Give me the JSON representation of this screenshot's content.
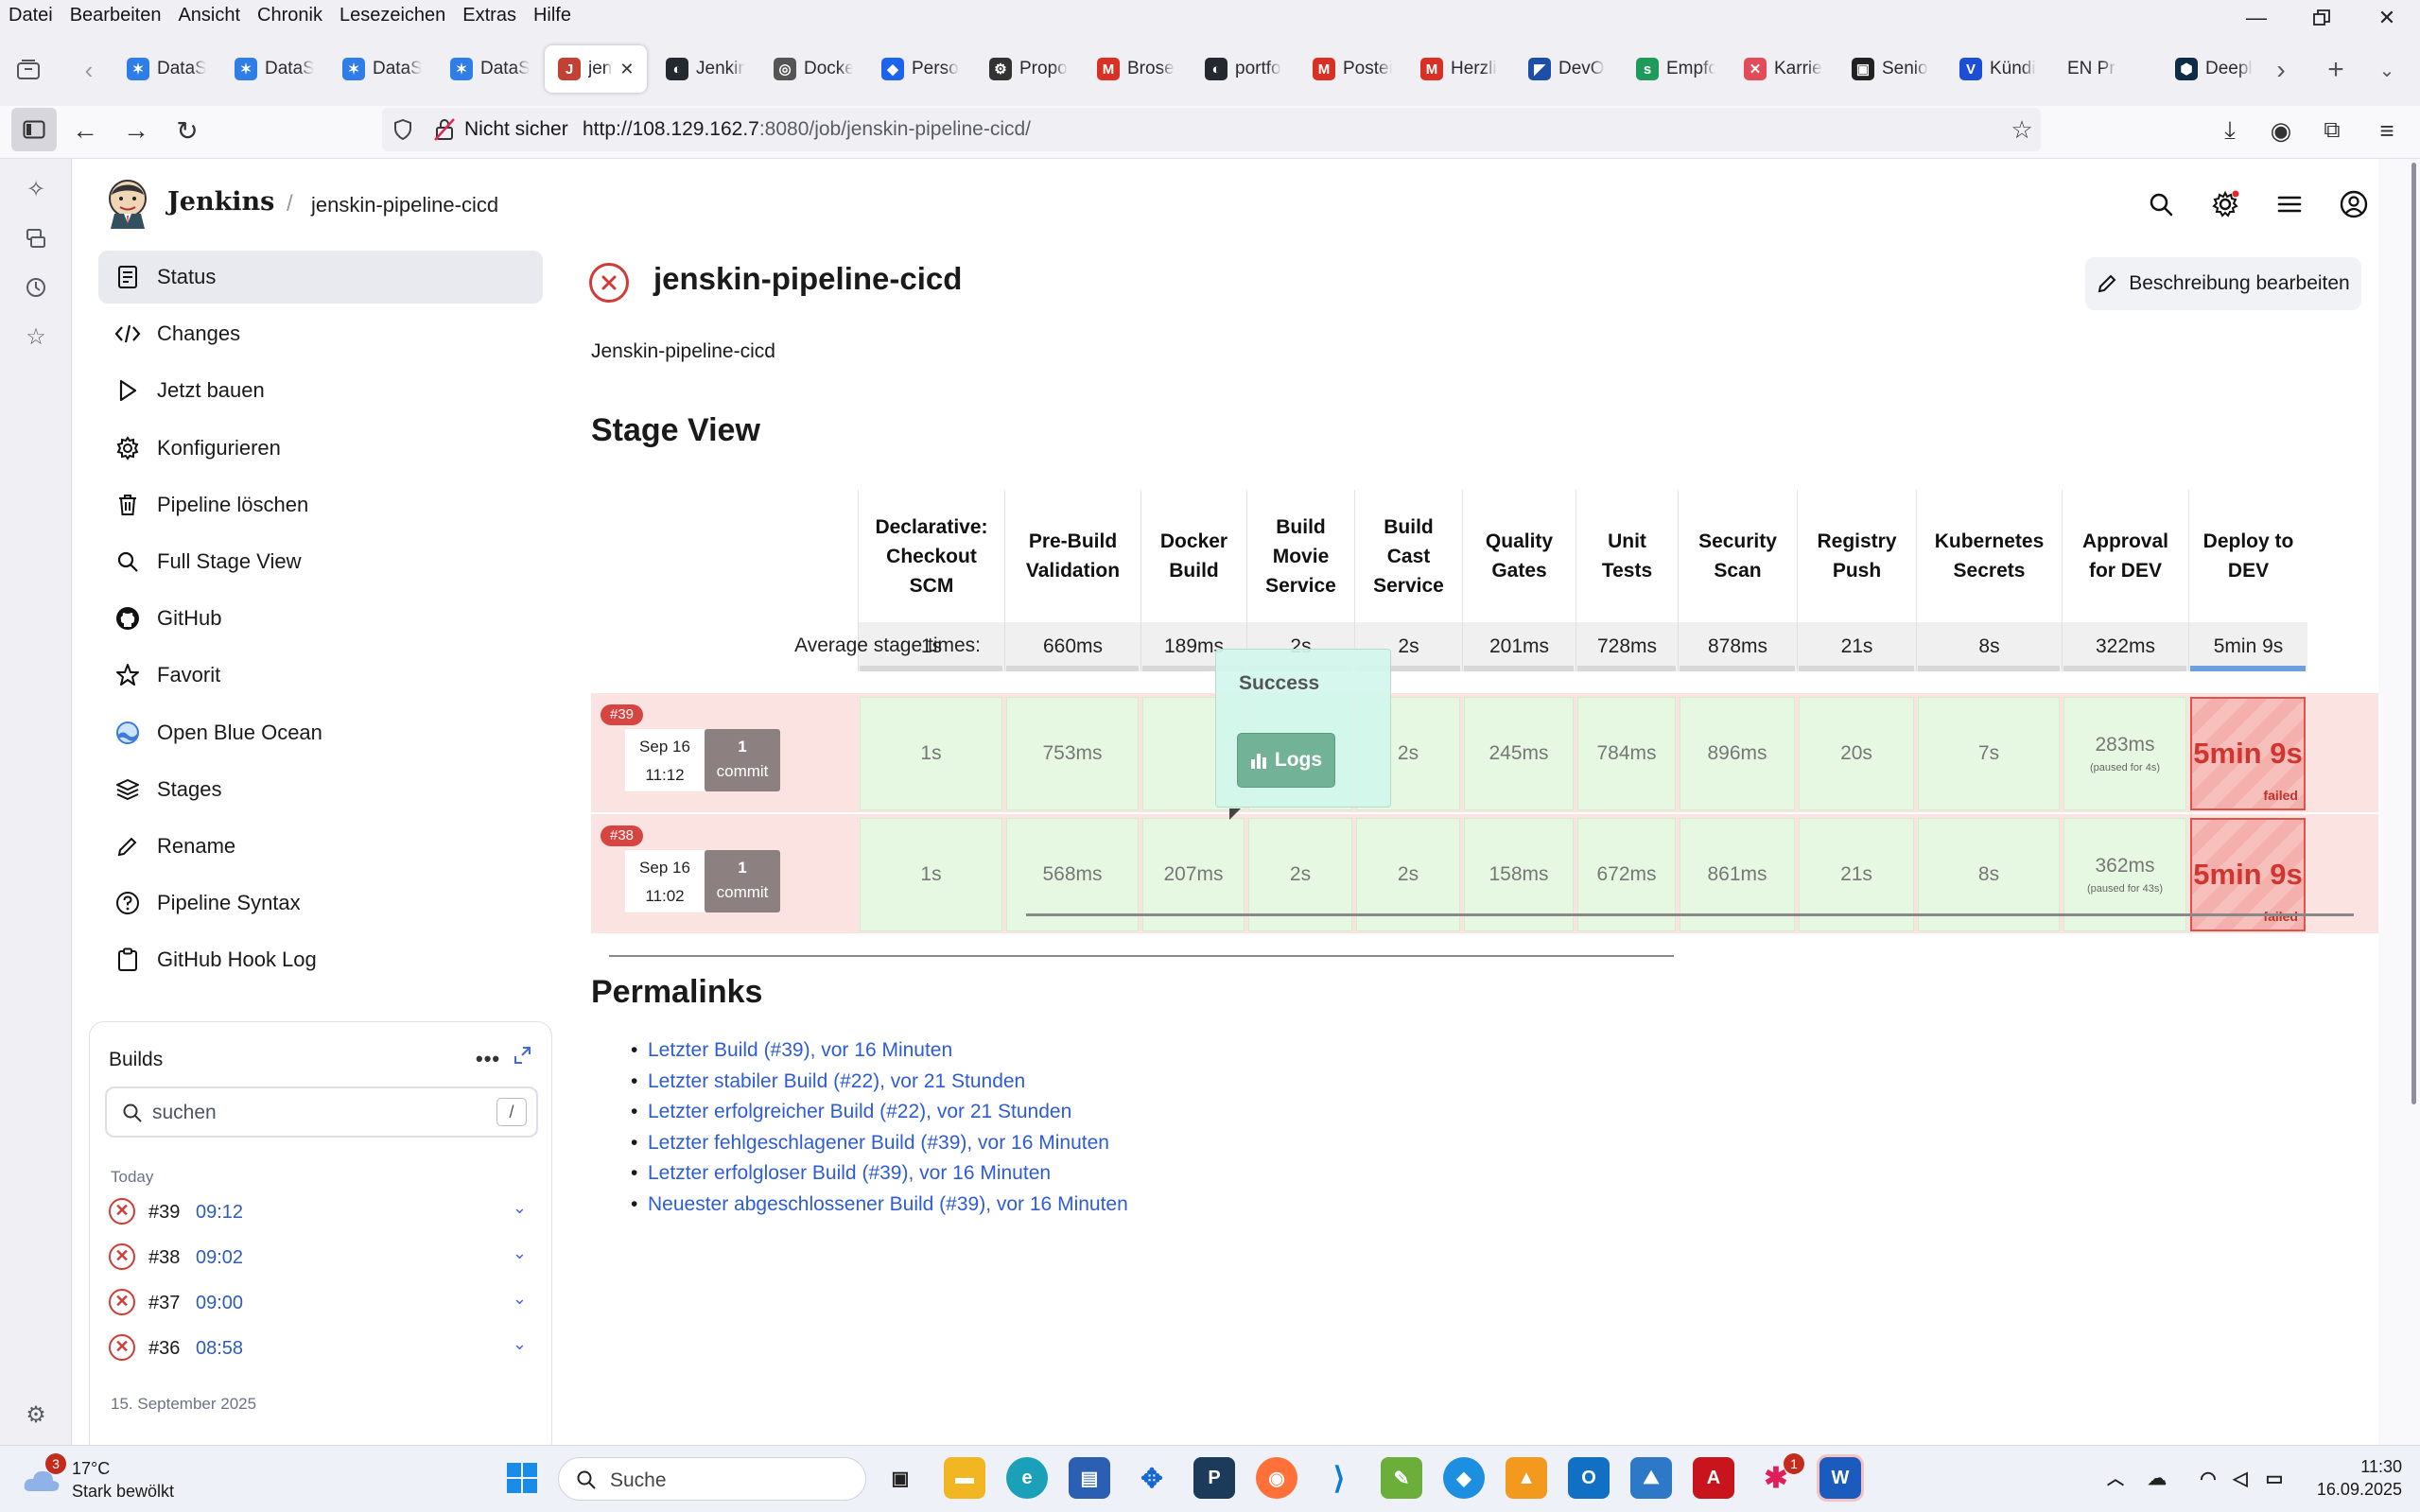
{
  "browser": {
    "menu": [
      "Datei",
      "Bearbeiten",
      "Ansicht",
      "Chronik",
      "Lesezeichen",
      "Extras",
      "Hilfe"
    ],
    "tabs": [
      {
        "label": "DataS",
        "color": "#2f7ee8",
        "glyph": "✶"
      },
      {
        "label": "DataS",
        "color": "#2f7ee8",
        "glyph": "✶"
      },
      {
        "label": "DataS",
        "color": "#2f7ee8",
        "glyph": "✶"
      },
      {
        "label": "DataS",
        "color": "#2f7ee8",
        "glyph": "✶"
      },
      {
        "label": "jen",
        "color": "#c24133",
        "glyph": "J"
      },
      {
        "label": "Jenkin",
        "color": "#24292f",
        "glyph": "◐"
      },
      {
        "label": "Docke",
        "color": "#555555",
        "glyph": "◎"
      },
      {
        "label": "Perso",
        "color": "#1d63ed",
        "glyph": "◆"
      },
      {
        "label": "Propo",
        "color": "#333333",
        "glyph": "⚙"
      },
      {
        "label": "Brose",
        "color": "#d93025",
        "glyph": "M"
      },
      {
        "label": "portfo",
        "color": "#24292f",
        "glyph": "◐"
      },
      {
        "label": "Postei",
        "color": "#d93025",
        "glyph": "M"
      },
      {
        "label": "Herzli",
        "color": "#d93025",
        "glyph": "M"
      },
      {
        "label": "DevO",
        "color": "#1e4fa8",
        "glyph": "◤"
      },
      {
        "label": "Empfo",
        "color": "#1e9b5a",
        "glyph": "s"
      },
      {
        "label": "Karrie",
        "color": "#e34b5b",
        "glyph": "✕"
      },
      {
        "label": "Senio",
        "color": "#222222",
        "glyph": "▣"
      },
      {
        "label": "Kündi",
        "color": "#1d4ed8",
        "glyph": "V"
      },
      {
        "label": "EN Project",
        "color": "#ffffff",
        "glyph": ""
      },
      {
        "label": "Deepl",
        "color": "#0f2b46",
        "glyph": "⬢"
      }
    ],
    "insecure_label": "Nicht sicher",
    "url_host": "http://108.129.162.7",
    "url_rest": ":8080/job/jenskin-pipeline-cicd/"
  },
  "jenkins": {
    "brand": "Jenkins",
    "breadcrumb": "jenskin-pipeline-cicd",
    "nav": [
      {
        "label": "Status",
        "icon": "status-icon"
      },
      {
        "label": "Changes",
        "icon": "code-icon"
      },
      {
        "label": "Jetzt bauen",
        "icon": "play-icon"
      },
      {
        "label": "Konfigurieren",
        "icon": "gear-icon"
      },
      {
        "label": "Pipeline löschen",
        "icon": "trash-icon"
      },
      {
        "label": "Full Stage View",
        "icon": "search-icon"
      },
      {
        "label": "GitHub",
        "icon": "github-icon"
      },
      {
        "label": "Favorit",
        "icon": "star-icon"
      },
      {
        "label": "Open Blue Ocean",
        "icon": "blue-ocean-icon"
      },
      {
        "label": "Stages",
        "icon": "layers-icon"
      },
      {
        "label": "Rename",
        "icon": "pencil-icon"
      },
      {
        "label": "Pipeline Syntax",
        "icon": "help-icon"
      },
      {
        "label": "GitHub Hook Log",
        "icon": "clipboard-icon"
      }
    ],
    "builds": {
      "title": "Builds",
      "search_placeholder": "suchen",
      "shortcut": "/",
      "today_label": "Today",
      "items": [
        {
          "num": "#39",
          "time": "09:12"
        },
        {
          "num": "#38",
          "time": "09:02"
        },
        {
          "num": "#37",
          "time": "09:00"
        },
        {
          "num": "#36",
          "time": "08:58"
        }
      ],
      "prev_day_label": "15. September 2025"
    },
    "title": "jenskin-pipeline-cicd",
    "edit_button": "Beschreibung bearbeiten",
    "description": "Jenskin-pipeline-cicd",
    "stage_view_title": "Stage View",
    "avg_label": "Average stage times:",
    "stages": [
      {
        "name": "Declarative: Checkout SCM",
        "avg": "1s"
      },
      {
        "name": "Pre-Build Validation",
        "avg": "660ms"
      },
      {
        "name": "Docker Build",
        "avg": "189ms"
      },
      {
        "name": "Build Movie Service",
        "avg": "2s"
      },
      {
        "name": "Build Cast Service",
        "avg": "2s"
      },
      {
        "name": "Quality Gates",
        "avg": "201ms"
      },
      {
        "name": "Unit Tests",
        "avg": "728ms"
      },
      {
        "name": "Security Scan",
        "avg": "878ms"
      },
      {
        "name": "Registry Push",
        "avg": "21s"
      },
      {
        "name": "Kubernetes Secrets",
        "avg": "8s"
      },
      {
        "name": "Approval for DEV",
        "avg": "322ms"
      },
      {
        "name": "Deploy to DEV",
        "avg": "5min 9s"
      }
    ],
    "runs": [
      {
        "badge": "#39",
        "date": "Sep 16",
        "time": "11:12",
        "commits": "1",
        "commit_label": "commit",
        "cells": [
          "1s",
          "753ms",
          "",
          "2s",
          "2s",
          "245ms",
          "784ms",
          "896ms",
          "20s",
          "7s",
          "283ms",
          "5min 9s"
        ],
        "approval_note": "(paused for 4s)"
      },
      {
        "badge": "#38",
        "date": "Sep 16",
        "time": "11:02",
        "commits": "1",
        "commit_label": "commit",
        "cells": [
          "1s",
          "568ms",
          "207ms",
          "2s",
          "2s",
          "158ms",
          "672ms",
          "861ms",
          "21s",
          "8s",
          "362ms",
          "5min 9s"
        ],
        "approval_note": "(paused for 43s)"
      }
    ],
    "failed_label": "failed",
    "popover": {
      "status": "Success",
      "logs": "Logs"
    },
    "permalinks_title": "Permalinks",
    "permalinks": [
      "Letzter Build (#39), vor 16 Minuten",
      "Letzter stabiler Build (#22), vor 21 Stunden",
      "Letzter erfolgreicher Build (#22), vor 21 Stunden",
      "Letzter fehlgeschlagener Build (#39), vor 16 Minuten",
      "Letzter erfolgloser Build (#39), vor 16 Minuten",
      "Neuester abgeschlossener Build (#39), vor 16 Minuten"
    ]
  },
  "taskbar": {
    "weather_temp": "17°C",
    "weather_desc": "Stark bewölkt",
    "weather_badge": "3",
    "search_label": "Suche",
    "slack_badge": "1",
    "time": "11:30",
    "date": "16.09.2025"
  }
}
